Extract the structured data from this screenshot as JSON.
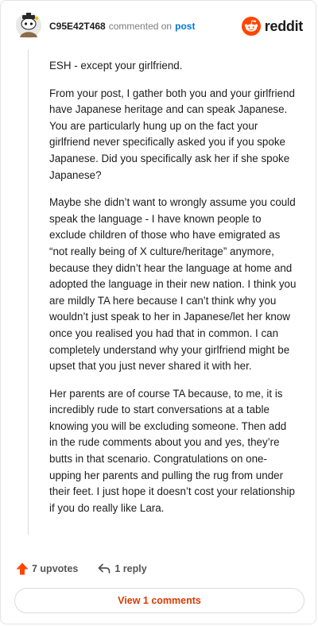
{
  "header": {
    "username": "C95E42T468",
    "action_text": "commented on",
    "post_link": "post",
    "brand_name": "reddit"
  },
  "comment": {
    "paragraphs": [
      "ESH - except your girlfriend.",
      "From your post, I gather both you and your girlfriend have Japanese heritage and can speak Japanese. You are particularly hung up on the fact your girlfriend never specifically asked you if you spoke Japanese. Did you specifically ask her if she spoke Japanese?",
      "Maybe she didn’t want to wrongly assume you could speak the language - I have known people to exclude children of those who have emigrated as “not really being of X culture/heritage” anymore, because they didn’t hear the language at home and adopted the language in their new nation. I think you are mildly TA here because I can’t think why you wouldn’t just speak to her in Japanese/let her know once you realised you had that in common. I can completely understand why your girlfriend might be upset that you just never shared it with her.",
      "Her parents are of course TA because, to me, it is incredibly rude to start conversations at a table knowing you will be excluding someone. Then add in the rude comments about you and yes, they’re butts in that scenario. Congratulations on one-upping her parents and pulling the rug from under their feet. I just hope it doesn’t cost your relationship if you do really like Lara."
    ]
  },
  "actions": {
    "upvotes_label": "7 upvotes",
    "reply_label": "1 reply",
    "view_comments_label": "View 1 comments"
  },
  "colors": {
    "brand_orange": "#ff4500",
    "link_blue": "#0079d3",
    "view_comments_text": "#d93a00"
  },
  "icons": {
    "avatar": "snoo-avatar",
    "brand": "reddit-logo-icon",
    "upvote": "upvote-arrow-icon",
    "reply": "reply-arrow-icon"
  }
}
